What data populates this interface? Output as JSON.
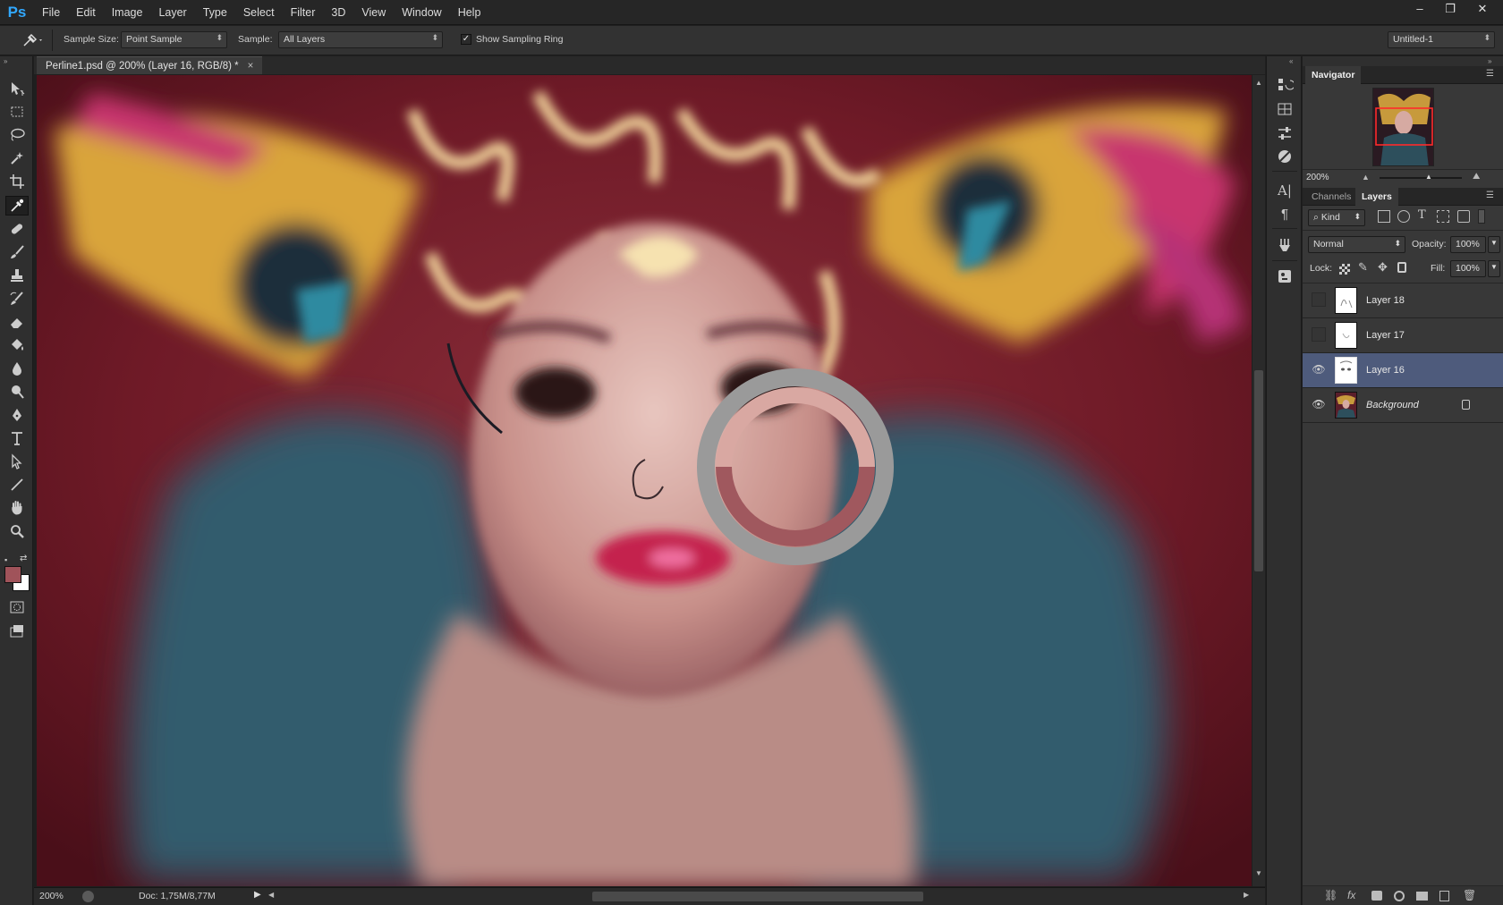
{
  "app": {
    "logo": "Ps"
  },
  "menu": [
    "File",
    "Edit",
    "Image",
    "Layer",
    "Type",
    "Select",
    "Filter",
    "3D",
    "View",
    "Window",
    "Help"
  ],
  "window_controls": {
    "minimize": "–",
    "restore": "❐",
    "close": "✕"
  },
  "options": {
    "sample_size_label": "Sample Size:",
    "sample_size_value": "Point Sample",
    "sample_label": "Sample:",
    "sample_value": "All Layers",
    "sampling_ring_label": "Show Sampling Ring",
    "sampling_ring_checked": true,
    "workspace": "Untitled-1"
  },
  "document": {
    "tab_title": "Perline1.psd @ 200% (Layer 16, RGB/8) *",
    "close": "×"
  },
  "status": {
    "zoom": "200%",
    "doc_info": "Doc: 1,75M/8,77M"
  },
  "colors": {
    "foreground": "#a0535a",
    "background": "#ffffff",
    "sample_top": "#d9a8a2",
    "sample_bottom": "#a0585e"
  },
  "tools": [
    "move-tool",
    "marquee-tool",
    "lasso-tool",
    "quick-select-tool",
    "crop-tool",
    "eyedropper-tool",
    "healing-tool",
    "brush-tool",
    "stamp-tool",
    "history-brush-tool",
    "eraser-tool",
    "bucket-tool",
    "blur-tool",
    "dodge-tool",
    "pen-tool",
    "type-tool",
    "path-select-tool",
    "line-tool",
    "hand-tool",
    "zoom-tool"
  ],
  "navigator": {
    "title": "Navigator",
    "zoom": "200%"
  },
  "layers_panel": {
    "tabs": [
      "Channels",
      "Layers"
    ],
    "active_tab": "Layers",
    "filter_kind": "Kind",
    "blend_mode": "Normal",
    "opacity_label": "Opacity:",
    "opacity": "100%",
    "lock_label": "Lock:",
    "fill_label": "Fill:",
    "fill": "100%",
    "layers": [
      {
        "name": "Layer 18",
        "visible": false,
        "selected": false
      },
      {
        "name": "Layer 17",
        "visible": false,
        "selected": false
      },
      {
        "name": "Layer 16",
        "visible": true,
        "selected": true
      },
      {
        "name": "Background",
        "visible": true,
        "selected": false,
        "locked": true
      }
    ]
  }
}
